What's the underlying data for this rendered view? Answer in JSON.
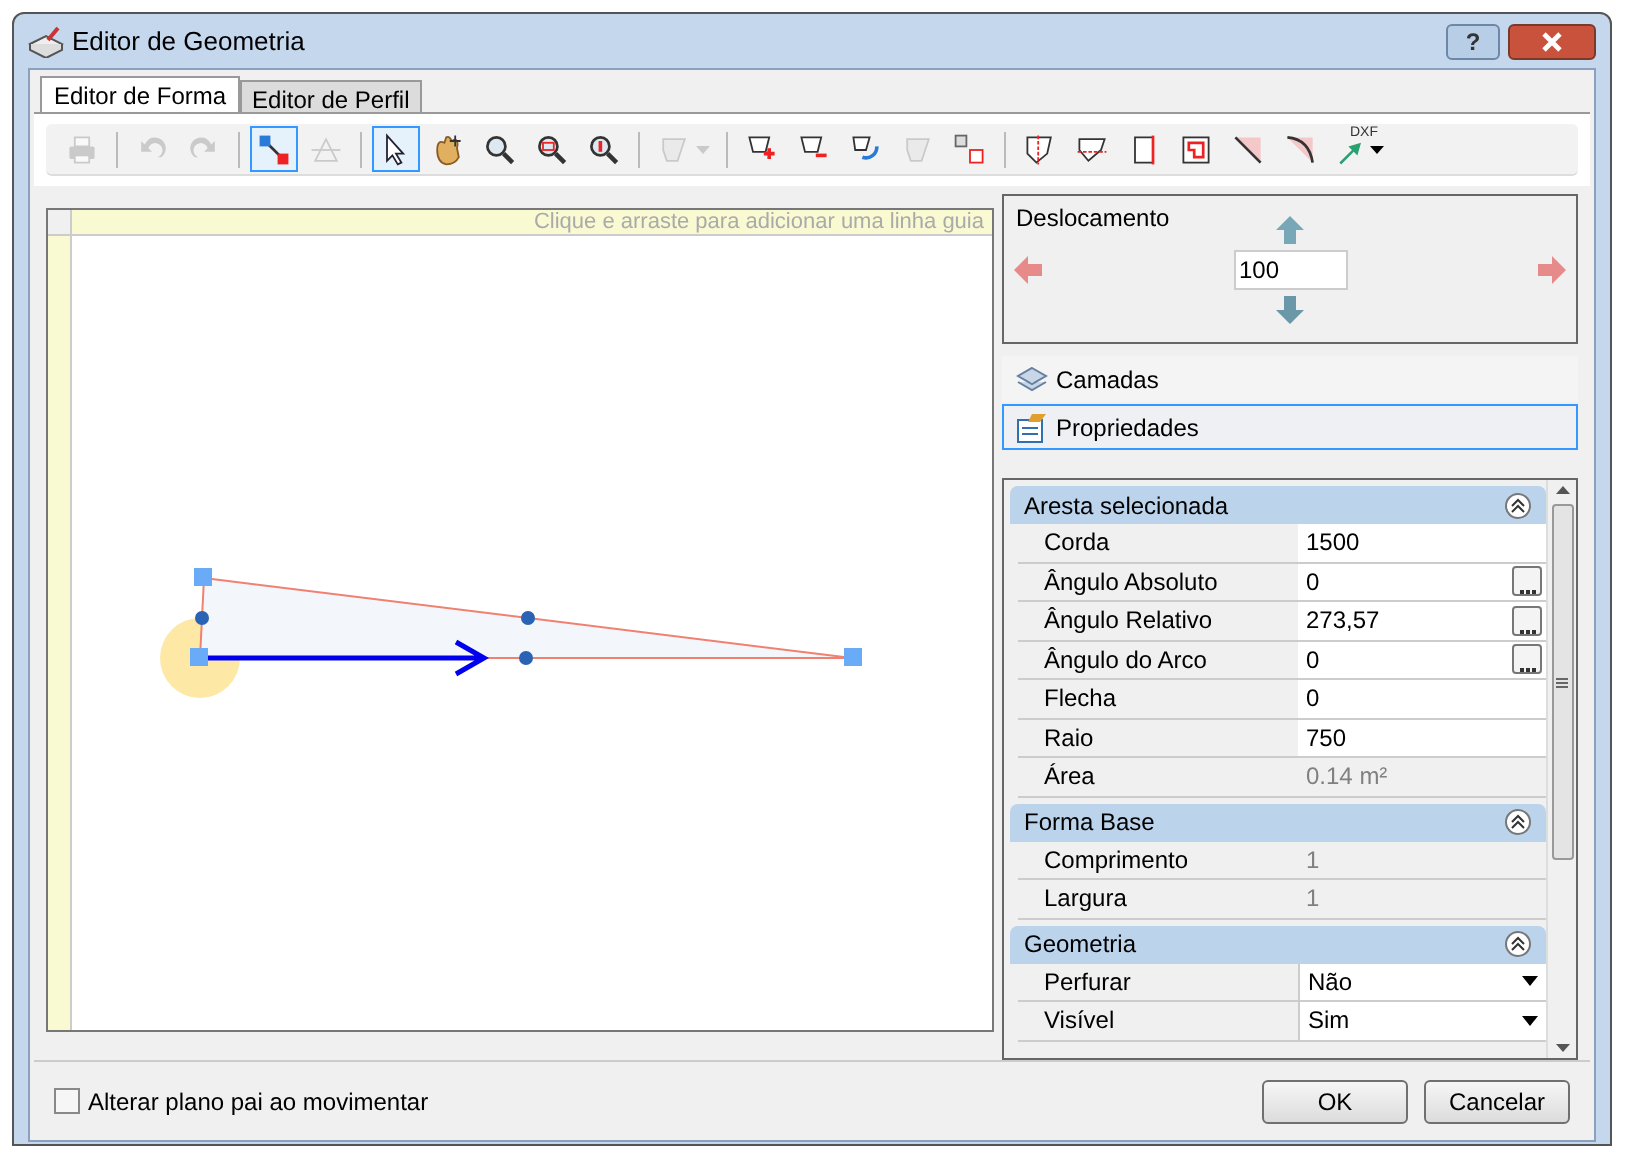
{
  "window": {
    "title": "Editor de Geometria",
    "help_button": "?"
  },
  "tabs": [
    {
      "label": "Editor de Forma",
      "selected": true
    },
    {
      "label": "Editor de Perfil",
      "selected": false
    }
  ],
  "toolbar": [
    {
      "kind": "button",
      "selected": false,
      "disabled": true
    },
    {
      "kind": "separator"
    },
    {
      "kind": "button",
      "selected": false,
      "disabled": true
    },
    {
      "kind": "button",
      "selected": false,
      "disabled": true
    },
    {
      "kind": "separator"
    },
    {
      "kind": "button",
      "selected": true,
      "disabled": false
    },
    {
      "kind": "button",
      "selected": false,
      "disabled": true
    },
    {
      "kind": "separator"
    },
    {
      "kind": "button",
      "selected": true,
      "disabled": false
    },
    {
      "kind": "button",
      "selected": false,
      "disabled": false
    },
    {
      "kind": "button",
      "selected": false,
      "disabled": false
    },
    {
      "kind": "button",
      "selected": false,
      "disabled": false
    },
    {
      "kind": "button",
      "selected": false,
      "disabled": false
    },
    {
      "kind": "separator"
    },
    {
      "kind": "dropdown",
      "selected": false,
      "disabled": true
    },
    {
      "kind": "separator"
    },
    {
      "kind": "button",
      "selected": false,
      "disabled": false
    },
    {
      "kind": "button",
      "selected": false,
      "disabled": false
    },
    {
      "kind": "button",
      "selected": false,
      "disabled": false
    },
    {
      "kind": "button",
      "selected": false,
      "disabled": true
    },
    {
      "kind": "button",
      "selected": false,
      "disabled": false
    },
    {
      "kind": "separator"
    },
    {
      "kind": "button",
      "selected": false,
      "disabled": false
    },
    {
      "kind": "button",
      "selected": false,
      "disabled": false
    },
    {
      "kind": "button",
      "selected": false,
      "disabled": false
    },
    {
      "kind": "button",
      "selected": false,
      "disabled": false
    },
    {
      "kind": "button",
      "selected": false,
      "disabled": false
    },
    {
      "kind": "button",
      "selected": false,
      "disabled": false
    },
    {
      "kind": "dxf",
      "label": "DXF",
      "selected": false,
      "disabled": false
    }
  ],
  "canvas": {
    "guide_hint": "Clique e arraste para adicionar uma linha guia"
  },
  "offset_panel": {
    "title": "Deslocamento",
    "value": "100"
  },
  "side_sections": [
    {
      "label": "Camadas",
      "selected": false
    },
    {
      "label": "Propriedades",
      "selected": true
    }
  ],
  "property_groups": [
    {
      "title": "Aresta selecionada",
      "expanded": true,
      "rows": [
        {
          "kind": "text",
          "label": "Corda",
          "value": "1500"
        },
        {
          "kind": "ellipsis",
          "label": "Ângulo Absoluto",
          "value": "0"
        },
        {
          "kind": "ellipsis",
          "label": "Ângulo Relativo",
          "value": "273,57"
        },
        {
          "kind": "ellipsis",
          "label": "Ângulo do Arco",
          "value": "0"
        },
        {
          "kind": "text",
          "label": "Flecha",
          "value": "0"
        },
        {
          "kind": "text",
          "label": "Raio",
          "value": "750"
        },
        {
          "kind": "readonly",
          "label": "Área",
          "value": "0.14 m²"
        }
      ]
    },
    {
      "title": "Forma Base",
      "expanded": true,
      "rows": [
        {
          "kind": "readonly",
          "label": "Comprimento",
          "value": "1"
        },
        {
          "kind": "readonly",
          "label": "Largura",
          "value": "1"
        }
      ]
    },
    {
      "title": "Geometria",
      "expanded": true,
      "rows": [
        {
          "kind": "dropdown",
          "label": "Perfurar",
          "value": "Não"
        },
        {
          "kind": "dropdown",
          "label": "Visível",
          "value": "Sim"
        }
      ]
    }
  ],
  "footer": {
    "checkbox": {
      "label": "Alterar plano pai ao movimentar",
      "checked": false
    },
    "buttons": [
      "OK",
      "Cancelar"
    ]
  }
}
